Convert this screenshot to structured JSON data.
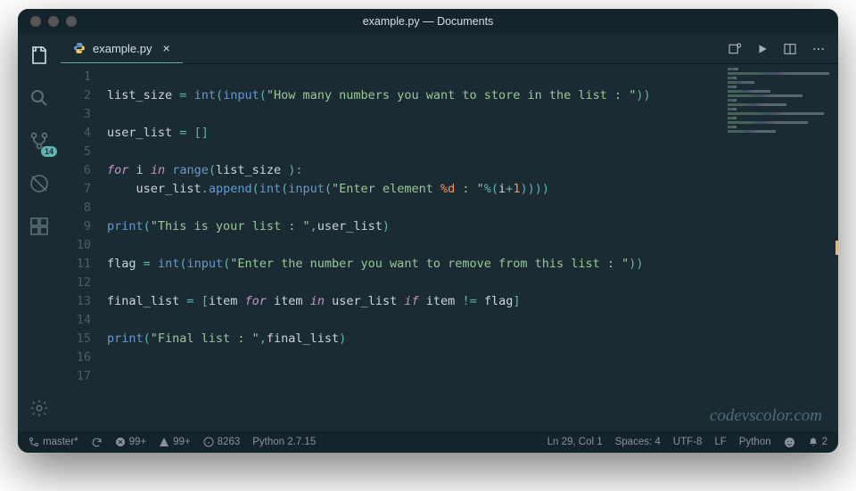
{
  "window": {
    "title": "example.py — Documents"
  },
  "tab": {
    "filename": "example.py"
  },
  "activitybar": {
    "scm_badge": "14"
  },
  "statusbar": {
    "branch": "master*",
    "errors": "99+",
    "warnings": "99+",
    "info": "8263",
    "interpreter": "Python 2.7.15",
    "cursor": "Ln 29, Col 1",
    "spaces": "Spaces: 4",
    "encoding": "UTF-8",
    "eol": "LF",
    "language": "Python",
    "bell": "2"
  },
  "watermark": "codevscolor.com",
  "code": {
    "line_count": 17,
    "lines": [
      {
        "n": 1,
        "tokens": []
      },
      {
        "n": 2,
        "tokens": [
          {
            "t": "list_size",
            "c": "t-var"
          },
          {
            "t": " ",
            "c": "t-white"
          },
          {
            "t": "=",
            "c": "t-op"
          },
          {
            "t": " ",
            "c": "t-white"
          },
          {
            "t": "int",
            "c": "t-func"
          },
          {
            "t": "(",
            "c": "t-punc"
          },
          {
            "t": "input",
            "c": "t-func"
          },
          {
            "t": "(",
            "c": "t-punc"
          },
          {
            "t": "\"How many numbers you want to store in the list : \"",
            "c": "t-str"
          },
          {
            "t": "))",
            "c": "t-punc"
          }
        ]
      },
      {
        "n": 3,
        "tokens": []
      },
      {
        "n": 4,
        "tokens": [
          {
            "t": "user_list",
            "c": "t-var"
          },
          {
            "t": " ",
            "c": "t-white"
          },
          {
            "t": "=",
            "c": "t-op"
          },
          {
            "t": " ",
            "c": "t-white"
          },
          {
            "t": "[]",
            "c": "t-punc"
          }
        ]
      },
      {
        "n": 5,
        "tokens": []
      },
      {
        "n": 6,
        "tokens": [
          {
            "t": "for",
            "c": "t-kw"
          },
          {
            "t": " ",
            "c": "t-white"
          },
          {
            "t": "i",
            "c": "t-var"
          },
          {
            "t": " ",
            "c": "t-white"
          },
          {
            "t": "in",
            "c": "t-kw"
          },
          {
            "t": " ",
            "c": "t-white"
          },
          {
            "t": "range",
            "c": "t-func"
          },
          {
            "t": "(",
            "c": "t-punc"
          },
          {
            "t": "list_size ",
            "c": "t-var"
          },
          {
            "t": "):",
            "c": "t-punc"
          }
        ]
      },
      {
        "n": 7,
        "tokens": [
          {
            "t": "    ",
            "c": "t-white"
          },
          {
            "t": "user_list",
            "c": "t-var"
          },
          {
            "t": ".",
            "c": "t-punc"
          },
          {
            "t": "append",
            "c": "t-func"
          },
          {
            "t": "(",
            "c": "t-punc"
          },
          {
            "t": "int",
            "c": "t-func"
          },
          {
            "t": "(",
            "c": "t-punc"
          },
          {
            "t": "input",
            "c": "t-func"
          },
          {
            "t": "(",
            "c": "t-punc"
          },
          {
            "t": "\"Enter element ",
            "c": "t-str"
          },
          {
            "t": "%d",
            "c": "t-num"
          },
          {
            "t": " : \"",
            "c": "t-str"
          },
          {
            "t": "%",
            "c": "t-op"
          },
          {
            "t": "(",
            "c": "t-punc"
          },
          {
            "t": "i",
            "c": "t-var"
          },
          {
            "t": "+",
            "c": "t-op"
          },
          {
            "t": "1",
            "c": "t-num"
          },
          {
            "t": "))))",
            "c": "t-punc"
          }
        ]
      },
      {
        "n": 8,
        "tokens": []
      },
      {
        "n": 9,
        "tokens": [
          {
            "t": "print",
            "c": "t-func"
          },
          {
            "t": "(",
            "c": "t-punc"
          },
          {
            "t": "\"This is your list : \"",
            "c": "t-str"
          },
          {
            "t": ",",
            "c": "t-punc"
          },
          {
            "t": "user_list",
            "c": "t-var"
          },
          {
            "t": ")",
            "c": "t-punc"
          }
        ]
      },
      {
        "n": 10,
        "tokens": []
      },
      {
        "n": 11,
        "tokens": [
          {
            "t": "flag",
            "c": "t-var"
          },
          {
            "t": " ",
            "c": "t-white"
          },
          {
            "t": "=",
            "c": "t-op"
          },
          {
            "t": " ",
            "c": "t-white"
          },
          {
            "t": "int",
            "c": "t-func"
          },
          {
            "t": "(",
            "c": "t-punc"
          },
          {
            "t": "input",
            "c": "t-func"
          },
          {
            "t": "(",
            "c": "t-punc"
          },
          {
            "t": "\"Enter the number you want to remove from this list : \"",
            "c": "t-str"
          },
          {
            "t": "))",
            "c": "t-punc"
          }
        ]
      },
      {
        "n": 12,
        "tokens": []
      },
      {
        "n": 13,
        "tokens": [
          {
            "t": "final_list",
            "c": "t-var"
          },
          {
            "t": " ",
            "c": "t-white"
          },
          {
            "t": "=",
            "c": "t-op"
          },
          {
            "t": " ",
            "c": "t-white"
          },
          {
            "t": "[",
            "c": "t-punc"
          },
          {
            "t": "item",
            "c": "t-var"
          },
          {
            "t": " ",
            "c": "t-white"
          },
          {
            "t": "for",
            "c": "t-kw"
          },
          {
            "t": " ",
            "c": "t-white"
          },
          {
            "t": "item",
            "c": "t-var"
          },
          {
            "t": " ",
            "c": "t-white"
          },
          {
            "t": "in",
            "c": "t-kw"
          },
          {
            "t": " ",
            "c": "t-white"
          },
          {
            "t": "user_list",
            "c": "t-var"
          },
          {
            "t": " ",
            "c": "t-white"
          },
          {
            "t": "if",
            "c": "t-kw"
          },
          {
            "t": " ",
            "c": "t-white"
          },
          {
            "t": "item",
            "c": "t-var"
          },
          {
            "t": " ",
            "c": "t-white"
          },
          {
            "t": "!=",
            "c": "t-op"
          },
          {
            "t": " ",
            "c": "t-white"
          },
          {
            "t": "flag",
            "c": "t-var"
          },
          {
            "t": "]",
            "c": "t-punc"
          }
        ]
      },
      {
        "n": 14,
        "tokens": []
      },
      {
        "n": 15,
        "tokens": [
          {
            "t": "print",
            "c": "t-func"
          },
          {
            "t": "(",
            "c": "t-punc"
          },
          {
            "t": "\"Final list : \"",
            "c": "t-str"
          },
          {
            "t": ",",
            "c": "t-punc"
          },
          {
            "t": "final_list",
            "c": "t-var"
          },
          {
            "t": ")",
            "c": "t-punc"
          }
        ]
      },
      {
        "n": 16,
        "tokens": []
      },
      {
        "n": 17,
        "tokens": []
      }
    ]
  }
}
